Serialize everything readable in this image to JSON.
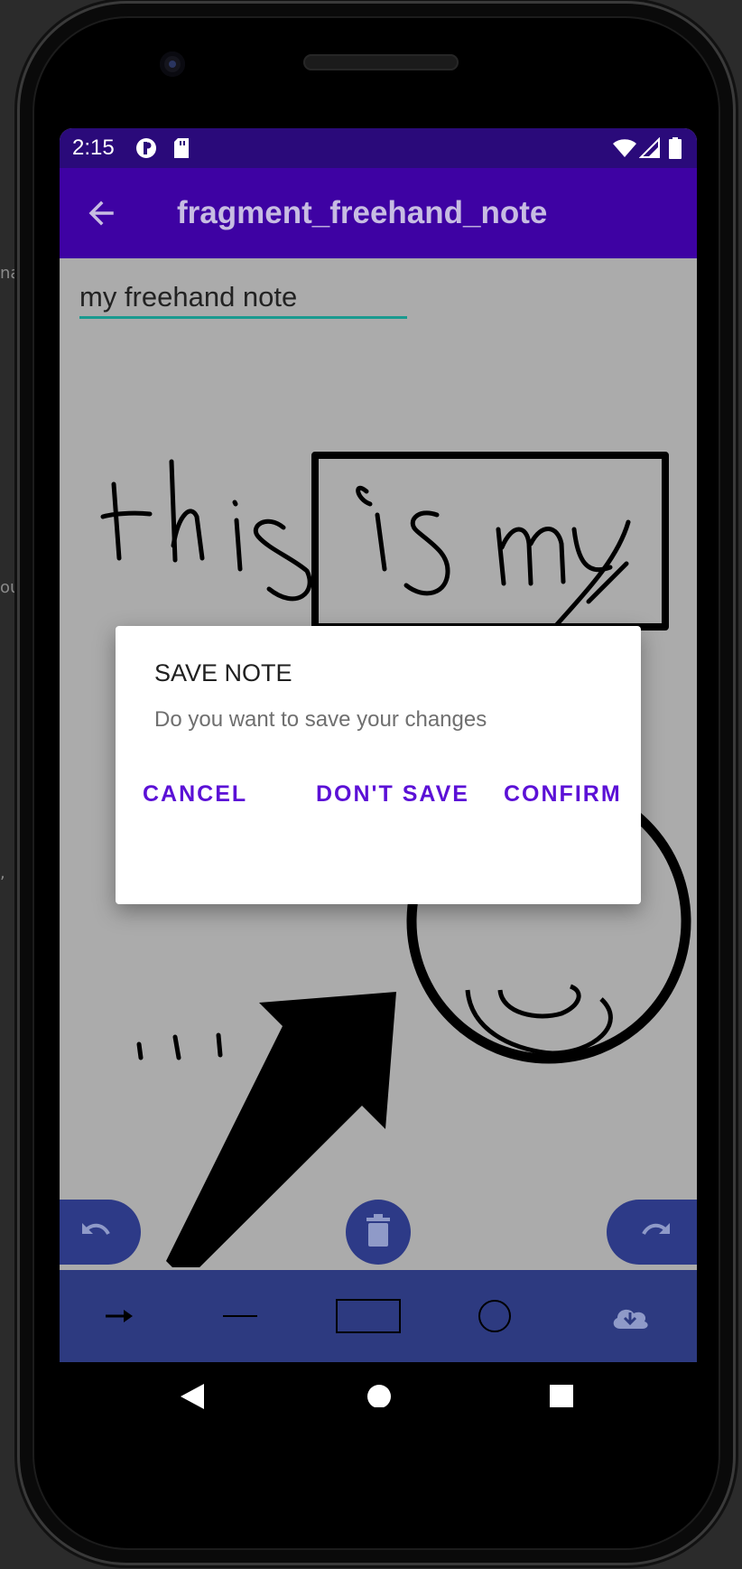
{
  "side_text": [
    "na",
    "ou",
    ","
  ],
  "status_bar": {
    "time": "2:15",
    "icons": [
      "app-notification-icon",
      "sd-card-icon",
      "wifi-icon",
      "signal-icon",
      "battery-icon"
    ]
  },
  "app_bar": {
    "title": "fragment_freehand_note",
    "back_icon": "arrow-back-icon"
  },
  "note": {
    "title_value": "my freehand note"
  },
  "fabs": {
    "undo_icon": "undo-icon",
    "delete_icon": "trash-icon",
    "redo_icon": "redo-icon"
  },
  "toolbar": {
    "tools": [
      "arrow-tool-icon",
      "line-tool-icon",
      "rectangle-tool-icon",
      "circle-tool-icon",
      "cloud-download-icon"
    ]
  },
  "nav": {
    "icons": [
      "back-triangle-icon",
      "home-circle-icon",
      "recents-square-icon"
    ]
  },
  "dialog": {
    "title": "SAVE NOTE",
    "message": "Do you want to save your changes",
    "cancel": "CANCEL",
    "dont_save": "DON'T SAVE",
    "confirm": "CONFIRM"
  },
  "colors": {
    "status_bar": "#2a0a7a",
    "app_bar": "#3e02a3",
    "canvas": "#ababab",
    "toolbar": "#2d3a80",
    "accent": "#5b10d6",
    "input_underline": "#1a9a8f"
  }
}
